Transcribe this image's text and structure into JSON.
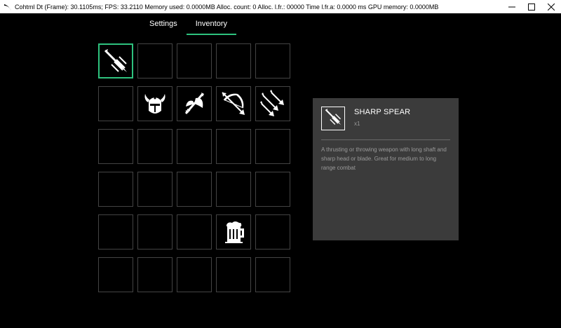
{
  "window": {
    "title": "Cohtml Dt (Frame): 30.1105ms; FPS: 33.2110 Memory used: 0.0000MB Alloc. count: 0 Alloc. l.fr.: 00000 Time l.fr.a: 0.0000 ms GPU memory: 0.0000MB",
    "minimize_label": "—",
    "maximize_label": "☐",
    "close_label": "✕"
  },
  "tabs": [
    {
      "label": "Settings",
      "active": false
    },
    {
      "label": "Inventory",
      "active": true
    }
  ],
  "inventory": {
    "rows": 6,
    "columns": 5,
    "items": [
      {
        "index": 0,
        "icon": "spear-icon",
        "selected": true
      },
      {
        "index": 6,
        "icon": "horned-helmet-icon"
      },
      {
        "index": 7,
        "icon": "axe-icon"
      },
      {
        "index": 8,
        "icon": "bow-arrow-icon"
      },
      {
        "index": 9,
        "icon": "arrows-icon"
      },
      {
        "index": 23,
        "icon": "beer-mug-icon"
      }
    ]
  },
  "details": {
    "icon": "spear-icon",
    "name": "SHARP SPEAR",
    "quantity": "x1",
    "description": "A thrusting or throwing weapon with long shaft and sharp head or blade. Great for medium to long range combat"
  },
  "colors": {
    "accent": "#2ec27e",
    "panel_bg": "#3b3b3b",
    "cell_border": "#444444",
    "muted_text": "#9a9a9a"
  }
}
